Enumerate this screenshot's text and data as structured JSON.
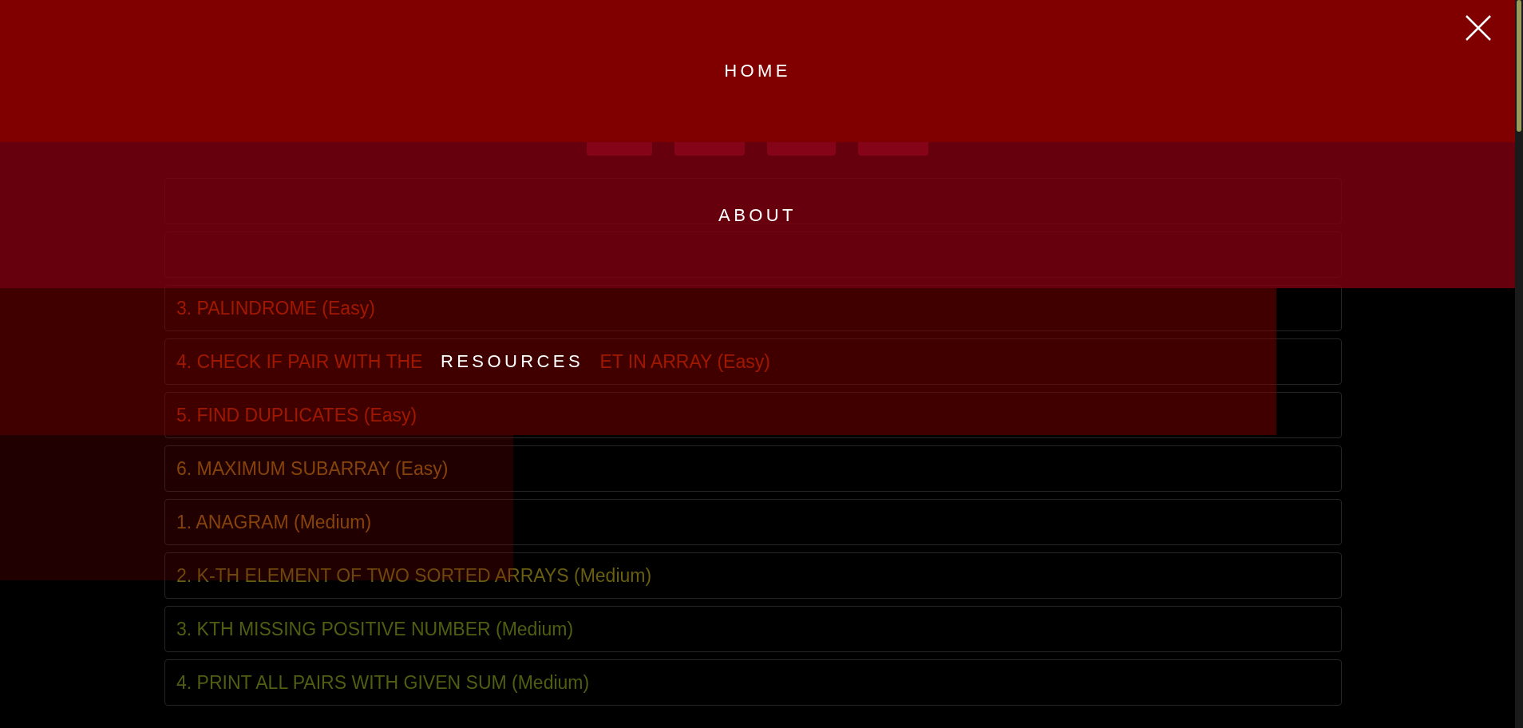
{
  "menu": {
    "items": [
      {
        "label": "HOME",
        "kind": "full"
      },
      {
        "label": "ABOUT",
        "kind": "full"
      },
      {
        "label": "RESOURCES",
        "kind": "partial"
      }
    ]
  },
  "problems": [
    {
      "kind": "hidden"
    },
    {
      "kind": "hidden"
    },
    {
      "kind": "plain",
      "text": "3. PALINDROME (Easy)"
    },
    {
      "kind": "split",
      "text": "4. CHECK IF PAIR WITH THE",
      "text_after": "ET IN ARRAY (Easy)"
    },
    {
      "kind": "plain",
      "text": "5. FIND DUPLICATES (Easy)"
    },
    {
      "kind": "plain",
      "text": "6. MAXIMUM SUBARRAY (Easy)"
    },
    {
      "kind": "plain",
      "text": "1. ANAGRAM (Medium)"
    },
    {
      "kind": "plain",
      "text": "2. K-TH ELEMENT OF TWO SORTED ARRAYS (Medium)"
    },
    {
      "kind": "plain",
      "text": "3. KTH MISSING POSITIVE NUMBER (Medium)"
    },
    {
      "kind": "plain",
      "text": "4. PRINT ALL PAIRS WITH GIVEN SUM (Medium)"
    }
  ]
}
